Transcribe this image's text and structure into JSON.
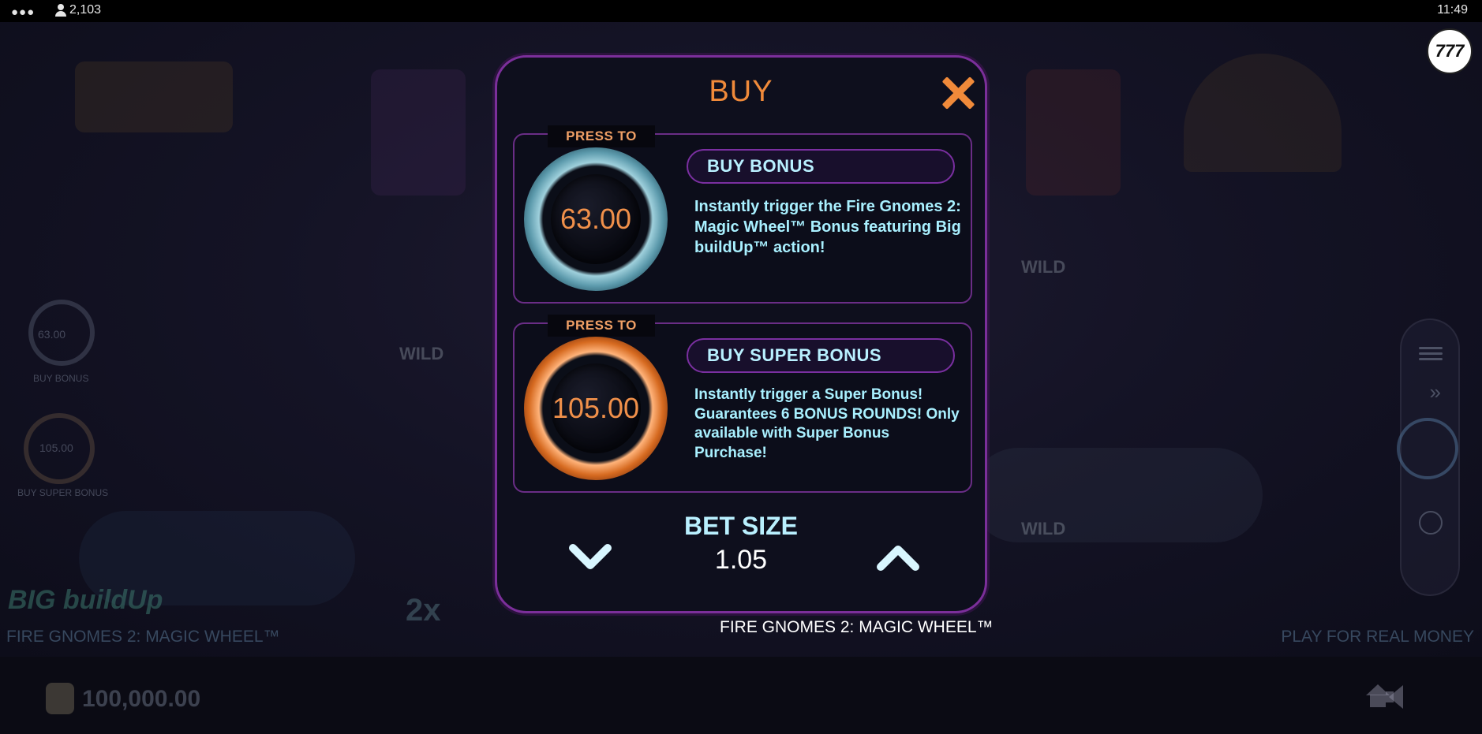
{
  "status_bar": {
    "menu_dots": "●●●",
    "players_count": "2,103",
    "time": "11:49"
  },
  "background": {
    "logo_badge": "777",
    "game_title": "FIRE GNOMES 2: MAGIC WHEEL™",
    "play_real_money": "PLAY FOR REAL MONEY",
    "balance": "100,000.00",
    "big_buildup": "BIG buildUp",
    "wild_labels": [
      "WILD",
      "WILD",
      "WILD"
    ],
    "multiplier": "2x",
    "mini_buy_bonus_value": "63.00",
    "mini_buy_bonus_label": "BUY BONUS",
    "mini_super_value": "105.00",
    "mini_super_label": "BUY SUPER BONUS"
  },
  "modal": {
    "title": "BUY",
    "close_icon": "close-x-icon",
    "accent_color": "#f08a3a",
    "border_color": "#7b2f9a",
    "options": [
      {
        "press_to": "PRESS TO",
        "price": "63.00",
        "label": "BUY BONUS",
        "description": "Instantly trigger the Fire Gnomes 2: Magic Wheel™ Bonus featuring Big buildUp™ action!",
        "orb_color": "blue"
      },
      {
        "press_to": "PRESS TO",
        "price": "105.00",
        "label": "BUY SUPER BONUS",
        "description": "Instantly trigger a Super Bonus! Guarantees 6 BONUS ROUNDS! Only available with Super Bonus Purchase!",
        "orb_color": "orange"
      }
    ],
    "bet": {
      "label": "BET SIZE",
      "value": "1.05",
      "decrease_icon": "chevron-down-icon",
      "increase_icon": "chevron-up-icon"
    }
  },
  "footer_game_name": "FIRE GNOMES 2: MAGIC WHEEL™"
}
